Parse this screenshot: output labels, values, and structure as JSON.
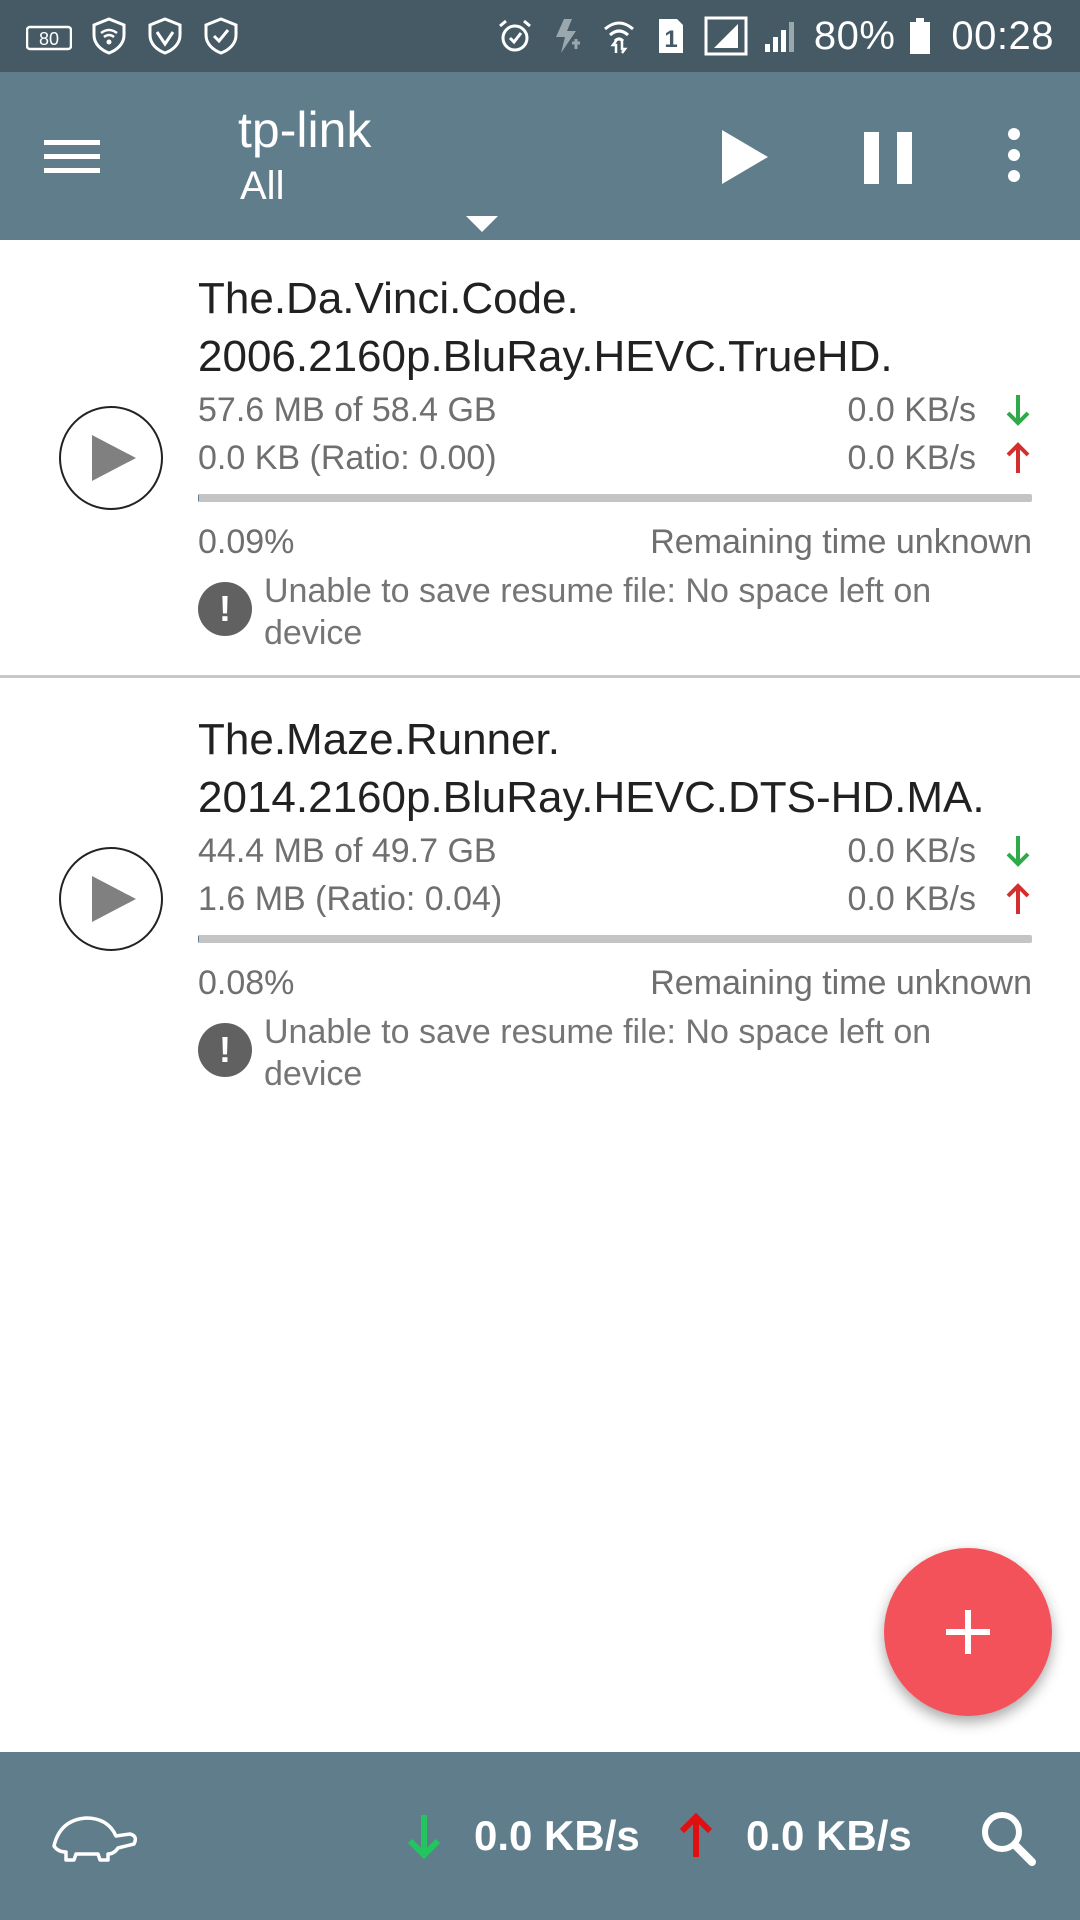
{
  "status_bar": {
    "left_icons": [
      "hd-voice-icon",
      "wifi-shield-icon",
      "shield-icon",
      "shield-check-icon"
    ],
    "hd_label": "80",
    "right_icons": [
      "alarm-icon",
      "flash-off-icon",
      "wifi-icon",
      "sim-1-icon",
      "signal-icon",
      "signal-icon-2"
    ],
    "sim_label": "1",
    "battery": "80%",
    "time": "00:28"
  },
  "toolbar": {
    "title": "tp-link",
    "subtitle": "All",
    "icons": [
      "menu-icon",
      "dropdown-icon",
      "play-icon",
      "pause-icon",
      "more-vert-icon"
    ]
  },
  "torrents": [
    {
      "name": "The.Da.Vinci.Code.\n2006.2160p.BluRay.HEVC.TrueHD.",
      "downloaded": "57.6 MB of 58.4 GB",
      "download_speed": "0.0 KB/s",
      "uploaded": "0.0 KB (Ratio: 0.00)",
      "upload_speed": "0.0 KB/s",
      "progress_percent": "0.09%",
      "progress": 0.0009,
      "remaining": "Remaining time unknown",
      "error": "Unable to save resume file: No space left on device"
    },
    {
      "name": "The.Maze.Runner.\n2014.2160p.BluRay.HEVC.DTS-HD.MA.",
      "downloaded": "44.4 MB of 49.7 GB",
      "download_speed": "0.0 KB/s",
      "uploaded": "1.6 MB (Ratio: 0.04)",
      "upload_speed": "0.0 KB/s",
      "progress_percent": "0.08%",
      "progress": 0.0008,
      "remaining": "Remaining time unknown",
      "error": "Unable to save resume file: No space left on device"
    }
  ],
  "bottom_bar": {
    "download_speed": "0.0 KB/s",
    "upload_speed": "0.0 KB/s",
    "icons": [
      "turtle-icon",
      "arrow-down-icon",
      "arrow-up-icon",
      "search-icon"
    ]
  },
  "fab": {
    "icon": "plus-icon"
  },
  "colors": {
    "status_bar": "#455a64",
    "toolbar": "#607d8b",
    "fab": "#f4525a",
    "download_arrow": "#2eaa48",
    "upload_arrow": "#d32f2f",
    "bottom_download_arrow": "#22c55e",
    "bottom_upload_arrow": "#e01010"
  }
}
